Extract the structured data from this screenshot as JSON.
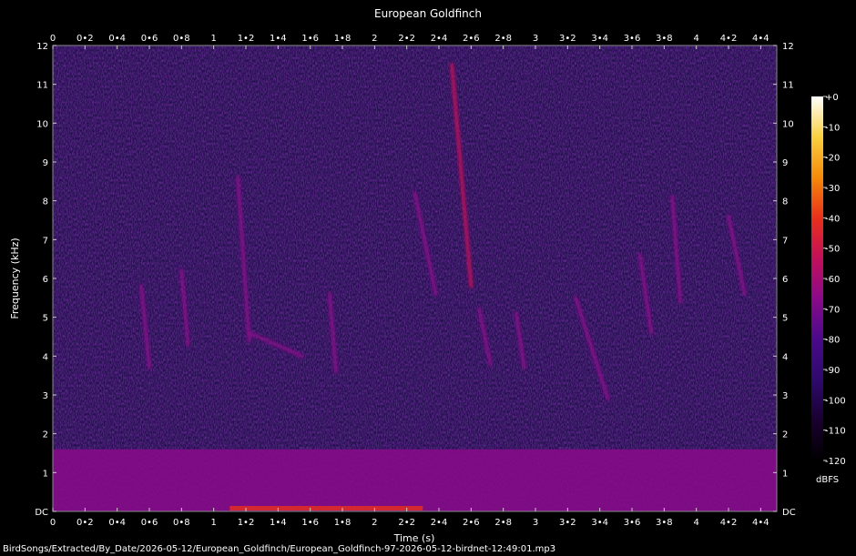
{
  "chart_data": {
    "type": "heatmap",
    "title": "European Goldfinch",
    "xlabel": "Time (s)",
    "ylabel": "Frequency (kHz)",
    "xlim": [
      0,
      4.5
    ],
    "ylim": [
      0,
      12
    ],
    "x_ticks": [
      "0",
      "0•2",
      "0•4",
      "0•6",
      "0•8",
      "1",
      "1•2",
      "1•4",
      "1•6",
      "1•8",
      "2",
      "2•2",
      "2•4",
      "2•6",
      "2•8",
      "3",
      "3•2",
      "3•4",
      "3•6",
      "3•8",
      "4",
      "4•2",
      "4•4"
    ],
    "x_tick_values": [
      0,
      0.2,
      0.4,
      0.6,
      0.8,
      1,
      1.2,
      1.4,
      1.6,
      1.8,
      2,
      2.2,
      2.4,
      2.6,
      2.8,
      3,
      3.2,
      3.4,
      3.6,
      3.8,
      4,
      4.2,
      4.4
    ],
    "y_ticks": [
      "DC",
      "1",
      "2",
      "3",
      "4",
      "5",
      "6",
      "7",
      "8",
      "9",
      "10",
      "11",
      "12"
    ],
    "y_tick_values": [
      0,
      1,
      2,
      3,
      4,
      5,
      6,
      7,
      8,
      9,
      10,
      11,
      12
    ],
    "colorbar": {
      "label": "dBFS",
      "ticks": [
        "+0",
        "-10",
        "-20",
        "-30",
        "-40",
        "-50",
        "-60",
        "-70",
        "-80",
        "-90",
        "-100",
        "-110",
        "-120"
      ],
      "tick_values": [
        0,
        -10,
        -20,
        -30,
        -40,
        -50,
        -60,
        -70,
        -80,
        -90,
        -100,
        -110,
        -120
      ],
      "range": [
        -120,
        0
      ]
    },
    "colormap": [
      "#000000",
      "#1a0030",
      "#2e0a6e",
      "#4a0a8a",
      "#8a0a8a",
      "#c2105a",
      "#e8301a",
      "#f58a0a",
      "#f8d040",
      "#ffffff"
    ],
    "noise_floor_db": -98,
    "low_band": {
      "f_max_khz": 1.6,
      "level_db": -72
    },
    "dc_band": {
      "x_range_s": [
        1.1,
        2.3
      ],
      "level_db": -40
    },
    "strokes": [
      {
        "t": [
          1.15,
          1.22
        ],
        "f": [
          8.6,
          4.4
        ],
        "db": -62
      },
      {
        "t": [
          1.22,
          1.55
        ],
        "f": [
          4.6,
          4.0
        ],
        "db": -66
      },
      {
        "t": [
          2.25,
          2.38
        ],
        "f": [
          8.2,
          5.6
        ],
        "db": -62
      },
      {
        "t": [
          2.48,
          2.6
        ],
        "f": [
          11.5,
          5.8
        ],
        "db": -58
      },
      {
        "t": [
          3.25,
          3.45
        ],
        "f": [
          5.5,
          2.9
        ],
        "db": -66
      },
      {
        "t": [
          4.2,
          4.3
        ],
        "f": [
          7.6,
          5.6
        ],
        "db": -66
      },
      {
        "t": [
          0.55,
          0.6
        ],
        "f": [
          5.8,
          3.7
        ],
        "db": -72
      },
      {
        "t": [
          0.8,
          0.84
        ],
        "f": [
          6.2,
          4.3
        ],
        "db": -72
      },
      {
        "t": [
          1.72,
          1.76
        ],
        "f": [
          5.6,
          3.6
        ],
        "db": -72
      },
      {
        "t": [
          2.65,
          2.72
        ],
        "f": [
          5.2,
          3.8
        ],
        "db": -72
      },
      {
        "t": [
          2.88,
          2.93
        ],
        "f": [
          5.1,
          3.7
        ],
        "db": -72
      },
      {
        "t": [
          3.85,
          3.9
        ],
        "f": [
          8.1,
          5.4
        ],
        "db": -70
      },
      {
        "t": [
          3.65,
          3.72
        ],
        "f": [
          6.6,
          4.6
        ],
        "db": -72
      }
    ],
    "file_label": "BirdSongs/Extracted/By_Date/2026-05-12/European_Goldfinch/European_Goldfinch-97-2026-05-12-birdnet-12:49:01.mp3"
  }
}
